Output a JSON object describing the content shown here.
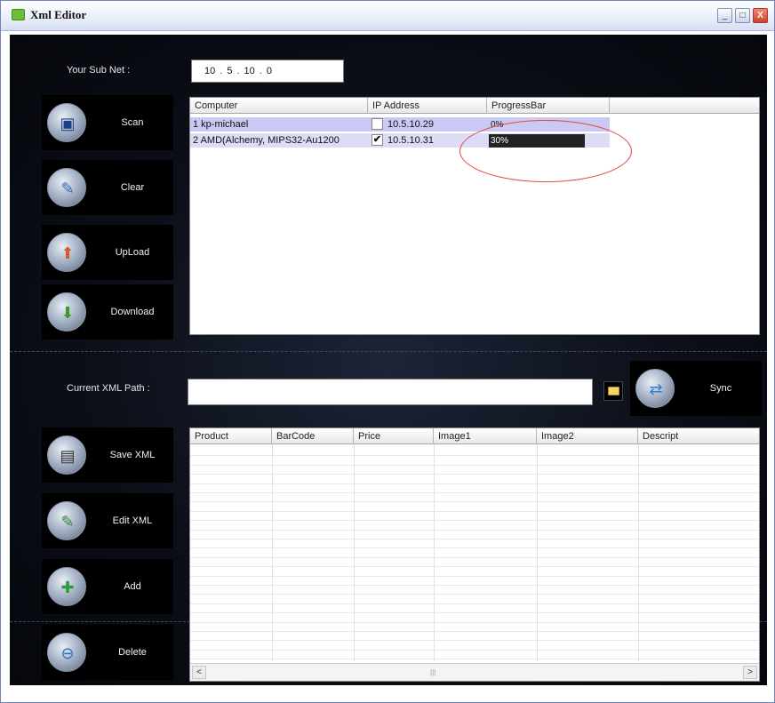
{
  "window": {
    "title": "Xml Editor",
    "controls": {
      "minimize": "_",
      "maximize": "□",
      "close": "X"
    }
  },
  "subnet": {
    "label": "Your Sub Net :",
    "octets": [
      "10",
      "5",
      "10",
      "0"
    ]
  },
  "side_buttons_top": [
    {
      "label": "Scan",
      "icon": "scan-icon"
    },
    {
      "label": "Clear",
      "icon": "clear-icon"
    },
    {
      "label": "UpLoad",
      "icon": "upload-icon"
    },
    {
      "label": "Download",
      "icon": "download-icon"
    }
  ],
  "computers_table": {
    "columns": [
      "Computer",
      "IP Address",
      "ProgressBar"
    ],
    "rows": [
      {
        "computer": "1 kp-michael",
        "checked": false,
        "ip": "10.5.10.29",
        "progress_text": "0%",
        "progress": 0
      },
      {
        "computer": "2 AMD(Alchemy, MIPS32-Au1200",
        "checked": true,
        "ip": "10.5.10.31",
        "progress_text": "30%",
        "progress": 30
      }
    ]
  },
  "xml_path": {
    "label": "Current XML Path :",
    "value": ""
  },
  "sync_button": {
    "label": "Sync",
    "icon": "sync-icon"
  },
  "side_buttons_bottom": [
    {
      "label": "Save XML",
      "icon": "save-xml-icon"
    },
    {
      "label": "Edit XML",
      "icon": "edit-xml-icon"
    },
    {
      "label": "Add",
      "icon": "add-icon"
    },
    {
      "label": "Delete",
      "icon": "delete-icon"
    }
  ],
  "products_table": {
    "columns": [
      "Product",
      "BarCode",
      "Price",
      "Image1",
      "Image2",
      "Descript"
    ],
    "rows": [],
    "scroll": {
      "left": "<",
      "right": ">",
      "grip": "|||"
    }
  },
  "colors": {
    "panel_bg": "#0c0f18",
    "row_highlight": "#c9c9f3",
    "annotation_ellipse": "#e04848",
    "progress_fill": "#222222"
  }
}
